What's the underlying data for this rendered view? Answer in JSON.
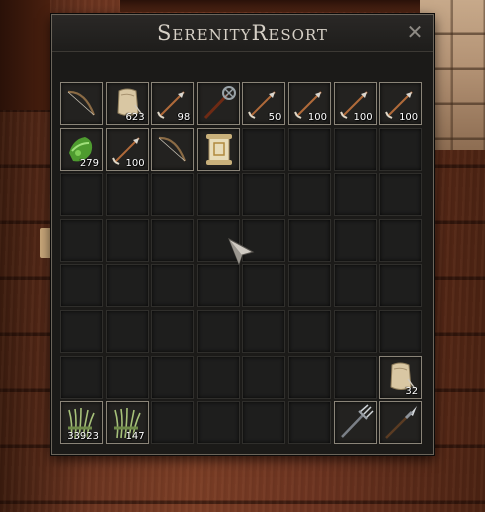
{
  "window": {
    "title": "SerenityResort",
    "close_glyph": "✕"
  },
  "grid": {
    "columns": 8,
    "rows": 8
  },
  "slots": [
    {
      "index": 0,
      "icon": "bow-icon",
      "qty": ""
    },
    {
      "index": 1,
      "icon": "cloth-sack-icon",
      "qty": "623"
    },
    {
      "index": 2,
      "icon": "arrow-icon",
      "qty": "98"
    },
    {
      "index": 3,
      "icon": "torch-staff-icon",
      "qty": ""
    },
    {
      "index": 4,
      "icon": "arrow-icon",
      "qty": "50"
    },
    {
      "index": 5,
      "icon": "arrow-icon",
      "qty": "100"
    },
    {
      "index": 6,
      "icon": "arrow-icon",
      "qty": "100"
    },
    {
      "index": 7,
      "icon": "arrow-icon",
      "qty": "100"
    },
    {
      "index": 8,
      "icon": "green-herb-icon",
      "qty": "279"
    },
    {
      "index": 9,
      "icon": "arrow-icon",
      "qty": "100"
    },
    {
      "index": 10,
      "icon": "bow-icon",
      "qty": ""
    },
    {
      "index": 11,
      "icon": "scroll-icon",
      "qty": ""
    },
    {
      "index": 55,
      "icon": "cloth-sack-icon",
      "qty": "32"
    },
    {
      "index": 56,
      "icon": "fiber-bundle-icon",
      "qty": "33923"
    },
    {
      "index": 57,
      "icon": "fiber-bundle-icon",
      "qty": "147"
    },
    {
      "index": 62,
      "icon": "trident-icon",
      "qty": ""
    },
    {
      "index": 63,
      "icon": "spear-icon",
      "qty": ""
    }
  ],
  "colors": {
    "window_bg": "#1b1a18",
    "slot_bg": "#1e1e1d",
    "title_text": "#d6d0c6"
  }
}
